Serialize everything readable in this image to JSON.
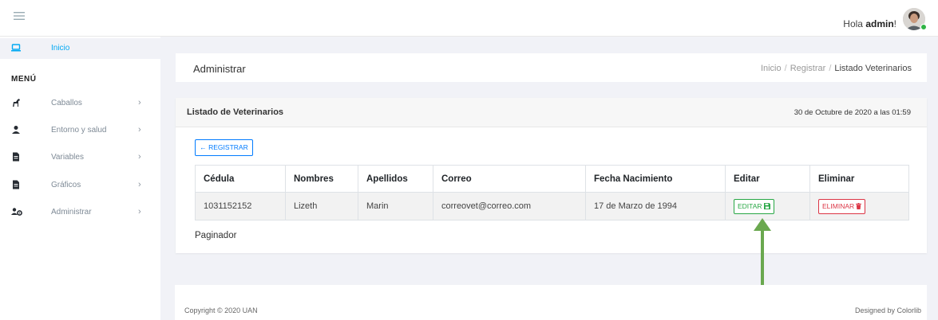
{
  "header": {
    "greeting_prefix": "Hola ",
    "greeting_user": "admin",
    "greeting_suffix": "!"
  },
  "sidebar": {
    "active_item": {
      "label": "Inicio",
      "icon": "laptop-icon"
    },
    "section_title": "MENÚ",
    "items": [
      {
        "label": "Caballos",
        "icon": "horse-icon"
      },
      {
        "label": "Entorno y salud",
        "icon": "user-icon"
      },
      {
        "label": "Variables",
        "icon": "file-icon"
      },
      {
        "label": "Gráficos",
        "icon": "file-icon"
      },
      {
        "label": "Administrar",
        "icon": "users-cog-icon"
      }
    ],
    "chevron": "›"
  },
  "breadcrumb": {
    "title": "Administrar",
    "trail": [
      "Inicio",
      "Registrar",
      "Listado Veterinarios"
    ],
    "separator": "/"
  },
  "card": {
    "title": "Listado de Veterinarios",
    "date": "30 de Octubre de 2020 a las 01:59",
    "registrar_label": "← REGISTRAR",
    "table": {
      "headers": [
        "Cédula",
        "Nombres",
        "Apellidos",
        "Correo",
        "Fecha Nacimiento",
        "Editar",
        "Eliminar"
      ],
      "rows": [
        {
          "cedula": "1031152152",
          "nombres": "Lizeth",
          "apellidos": "Marin",
          "correo": "correovet@correo.com",
          "fecha": "17 de Marzo de 1994",
          "editar_label": "EDITAR",
          "eliminar_label": "ELIMINAR"
        }
      ]
    },
    "paginador": "Paginador"
  },
  "footer": {
    "copyright": "Copyright © 2020 UAN",
    "designed_by": "Designed by Colorlib"
  },
  "colors": {
    "accent_blue": "#007bff",
    "success_green": "#28a745",
    "danger_red": "#dc3545",
    "sidebar_active": "#03a9f3",
    "annotation_arrow": "#6aa84f"
  }
}
